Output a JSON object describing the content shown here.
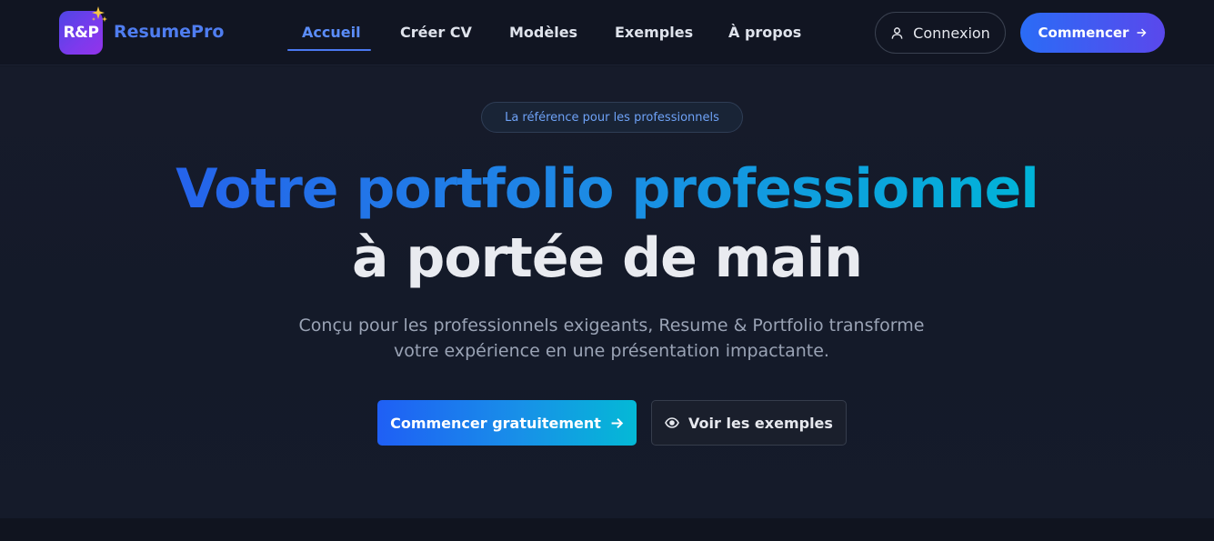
{
  "brand": {
    "logo_text": "R&P",
    "name": "ResumePro"
  },
  "nav": {
    "items": [
      {
        "label": "Accueil",
        "active": true
      },
      {
        "label": "Créer CV",
        "active": false
      },
      {
        "label": "Modèles",
        "active": false
      },
      {
        "label": "Exemples",
        "active": false
      },
      {
        "label": "À propos",
        "active": false
      }
    ]
  },
  "header_actions": {
    "login_label": "Connexion",
    "login_icon": "user-icon",
    "start_label": "Commencer",
    "start_icon": "arrow-right-icon"
  },
  "hero": {
    "badge": "La référence pour les professionnels",
    "headline_line1": "Votre portfolio professionnel",
    "headline_line2": "à portée de main",
    "subtitle_line1": "Conçu pour les professionnels exigeants, Resume & Portfolio transforme",
    "subtitle_line2": "votre expérience en une présentation impactante.",
    "primary_cta": "Commencer gratuitement",
    "primary_cta_icon": "arrow-right-icon",
    "secondary_cta": "Voir les exemples",
    "secondary_cta_icon": "eye-icon"
  },
  "colors": {
    "accent_blue": "#2563eb",
    "accent_cyan": "#00b4d8",
    "accent_violet": "#5a48ec",
    "background": "#121624"
  }
}
